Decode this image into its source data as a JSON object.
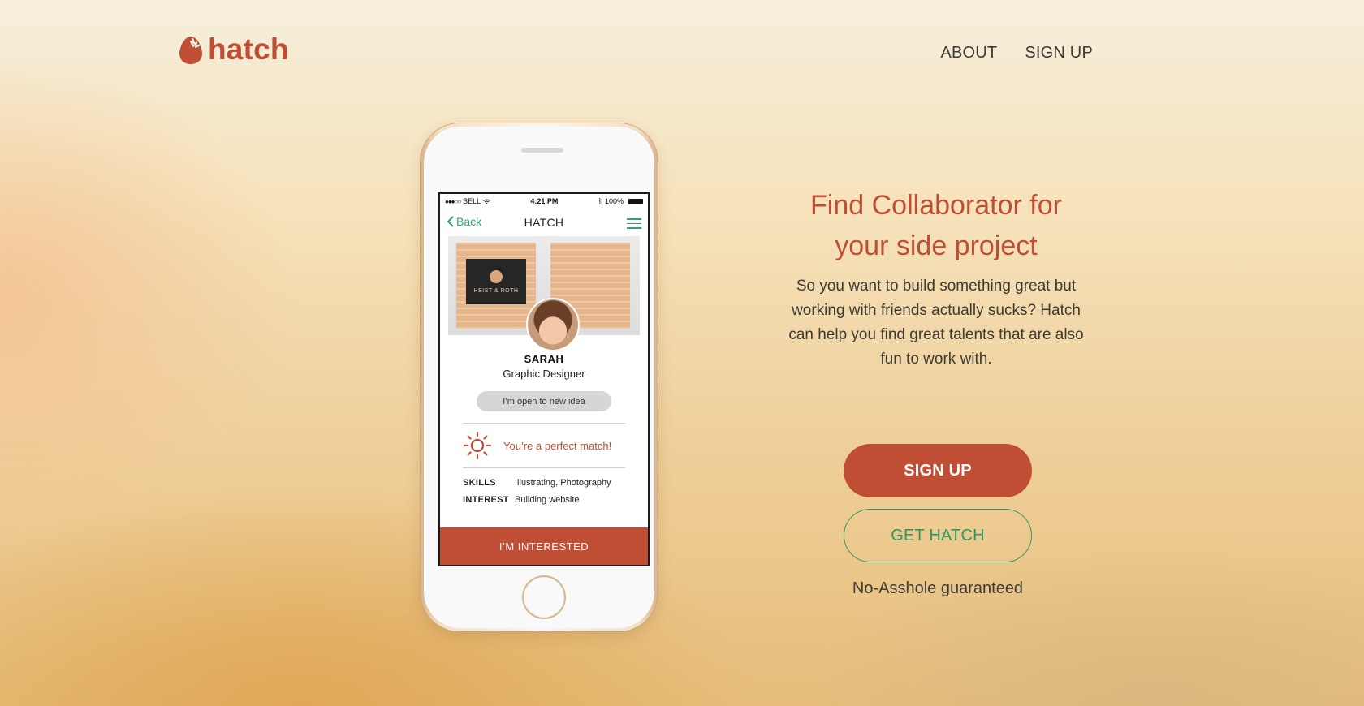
{
  "brand": {
    "name": "hatch",
    "accent": "#c04e34",
    "green": "#2ea56e",
    "logo_icon": "egg-icon"
  },
  "nav": {
    "about": "ABOUT",
    "signup": "SIGN UP"
  },
  "phone": {
    "status": {
      "carrier": "BELL",
      "time": "4:21 PM",
      "battery": "100%"
    },
    "navbar": {
      "back": "Back",
      "title": "HATCH"
    },
    "project": {
      "box_label": "HEIST & ROTH"
    },
    "profile": {
      "name": "SARAH",
      "role": "Graphic Designer",
      "status_pill": "I’m open to new idea"
    },
    "match": {
      "text": "You’re a perfect match!",
      "icon": "sun-icon"
    },
    "details": [
      {
        "key": "SKILLS",
        "value": "Illustrating, Photography"
      },
      {
        "key": "INTEREST",
        "value": "Building website"
      }
    ],
    "cta": "I’M INTERESTED"
  },
  "hero": {
    "title": "Find Collaborator for your side project",
    "text": "So you want to build something great but working with friends actually sucks? Hatch can help you find great talents that are also fun to work with."
  },
  "actions": {
    "signup": "SIGN UP",
    "get": "GET HATCH",
    "tagline": "No-Asshole guaranteed"
  }
}
